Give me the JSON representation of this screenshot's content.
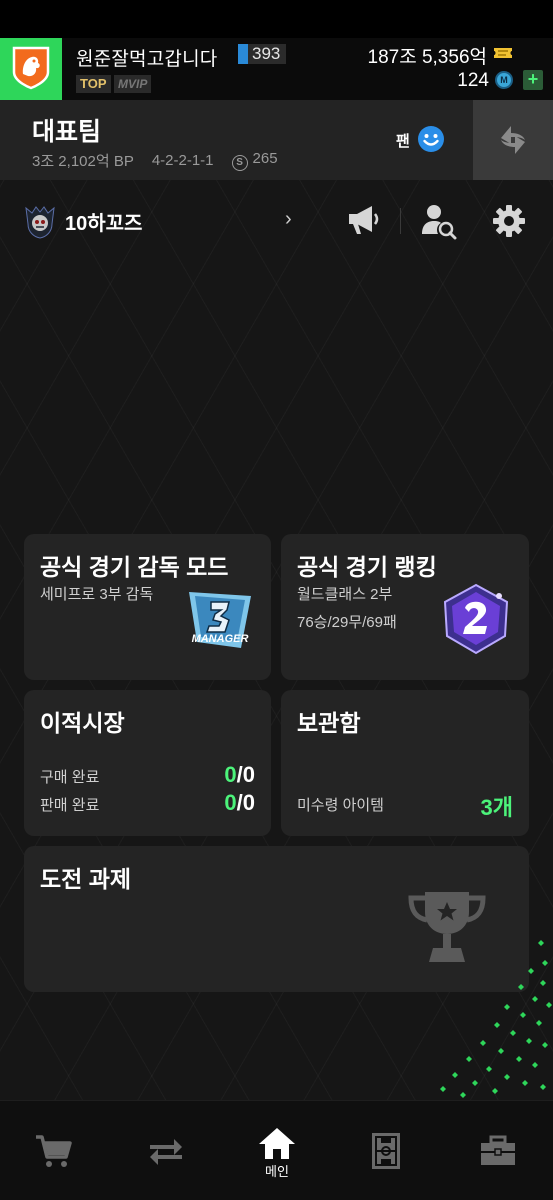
{
  "header": {
    "username": "원준잘먹고갑니다",
    "level": "393",
    "badges": [
      "TOP",
      "MVIP"
    ],
    "bp_amount": "187조 5,356억",
    "fc_amount": "124",
    "plus": "+"
  },
  "team": {
    "title": "대표팀",
    "value": "3조 2,102억 BP",
    "formation": "4-2-2-1-1",
    "salary": "265",
    "salary_icon": "S",
    "fan_label": "팬"
  },
  "guild": {
    "name": "10하꼬즈",
    "chevron": "›"
  },
  "cards": {
    "manager_mode": {
      "title": "공식 경기 감독 모드",
      "subtitle": "세미프로 3부 감독",
      "emblem_text": "MANAGER"
    },
    "ranking": {
      "title": "공식 경기 랭킹",
      "subtitle": "월드클래스 2부",
      "record": "76승/29무/69패"
    },
    "transfer": {
      "title": "이적시장",
      "buy_label": "구매 완료",
      "buy_done": "0",
      "buy_total": "/0",
      "sell_label": "판매 완료",
      "sell_done": "0",
      "sell_total": "/0"
    },
    "storage": {
      "title": "보관함",
      "unclaimed_label": "미수령 아이템",
      "unclaimed_count": "3개"
    },
    "challenge": {
      "title": "도전 과제"
    }
  },
  "nav": {
    "items": [
      "shop-cart-icon",
      "transfer-arrows-icon",
      "home-icon",
      "pitch-icon",
      "locker-icon"
    ],
    "active_label": "메인"
  },
  "colors": {
    "accent_green": "#4cf37a",
    "club_green": "#2ed65a",
    "card_bg": "#242424"
  }
}
